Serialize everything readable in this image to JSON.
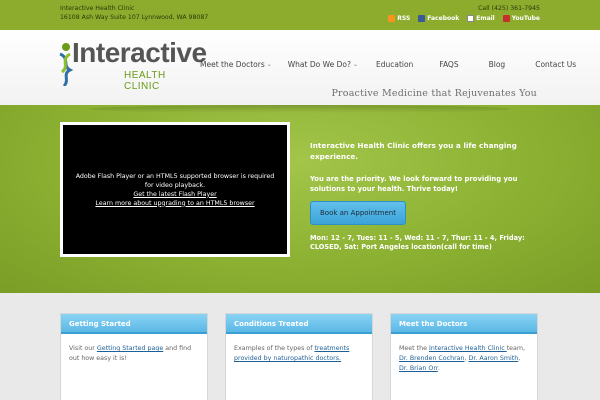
{
  "topbar": {
    "clinic_name": "Interactive Health Clinic",
    "address": "16108 Ash Way Suite 107 Lynnwood, WA 98087",
    "phone": "Call (425) 361-7945",
    "social": {
      "rss": "RSS",
      "facebook": "Facebook",
      "email": "Email",
      "youtube": "YouTube"
    }
  },
  "header": {
    "logo_word": "Interactive",
    "logo_sub": "HEALTH CLINIC",
    "nav": [
      {
        "label": "Meet the Doctors",
        "dropdown": true
      },
      {
        "label": "What Do We Do?",
        "dropdown": true
      },
      {
        "label": "Education",
        "dropdown": false
      },
      {
        "label": "FAQS",
        "dropdown": false
      },
      {
        "label": "Blog",
        "dropdown": false
      },
      {
        "label": "Contact Us",
        "dropdown": false
      }
    ],
    "tagline": "Proactive Medicine that Rejuvenates You"
  },
  "hero": {
    "video_message": "Adobe Flash Player or an HTML5 supported browser is required for video playback.",
    "flash_link": "Get the latest Flash Player",
    "html5_link": "Learn more about upgrading to an HTML5 browser",
    "headline": "Interactive Health Clinic offers you a life changing experience.",
    "priority": "You are the priority. We look forward to providing you solutions to your health. Thrive today!",
    "button": "Book an Appointment",
    "hours": "Mon: 12 - 7, Tues: 11 - 5, Wed: 11 - 7, Thur: 11 - 4, Friday: CLOSED, Sat: Port Angeles location(call for time)"
  },
  "cards": {
    "getting_started": {
      "title": "Getting Started",
      "text_before": "Visit our ",
      "link": "Getting Started page",
      "text_after": " and find out how easy it is!"
    },
    "conditions": {
      "title": "Conditions Treated",
      "text_before": "Examples of the types of ",
      "link": "treatments provided by naturopathic doctors."
    },
    "doctors": {
      "title": "Meet the Doctors",
      "text_before": "Meet the ",
      "link_clinic": "Interactive Health Clinic ",
      "text_mid": "team, ",
      "doctor1": "Dr. Brenden Cochran",
      "sep1": ", ",
      "doctor2": "Dr. Aaron Smith",
      "sep2": ", ",
      "doctor3": "Dr. Brian Orr",
      "end": "."
    }
  },
  "colors": {
    "topbar": "#8dac2e",
    "hero_green": "#8cb132",
    "accent_blue": "#5ab8e6",
    "logo_green": "#6a9a18"
  }
}
